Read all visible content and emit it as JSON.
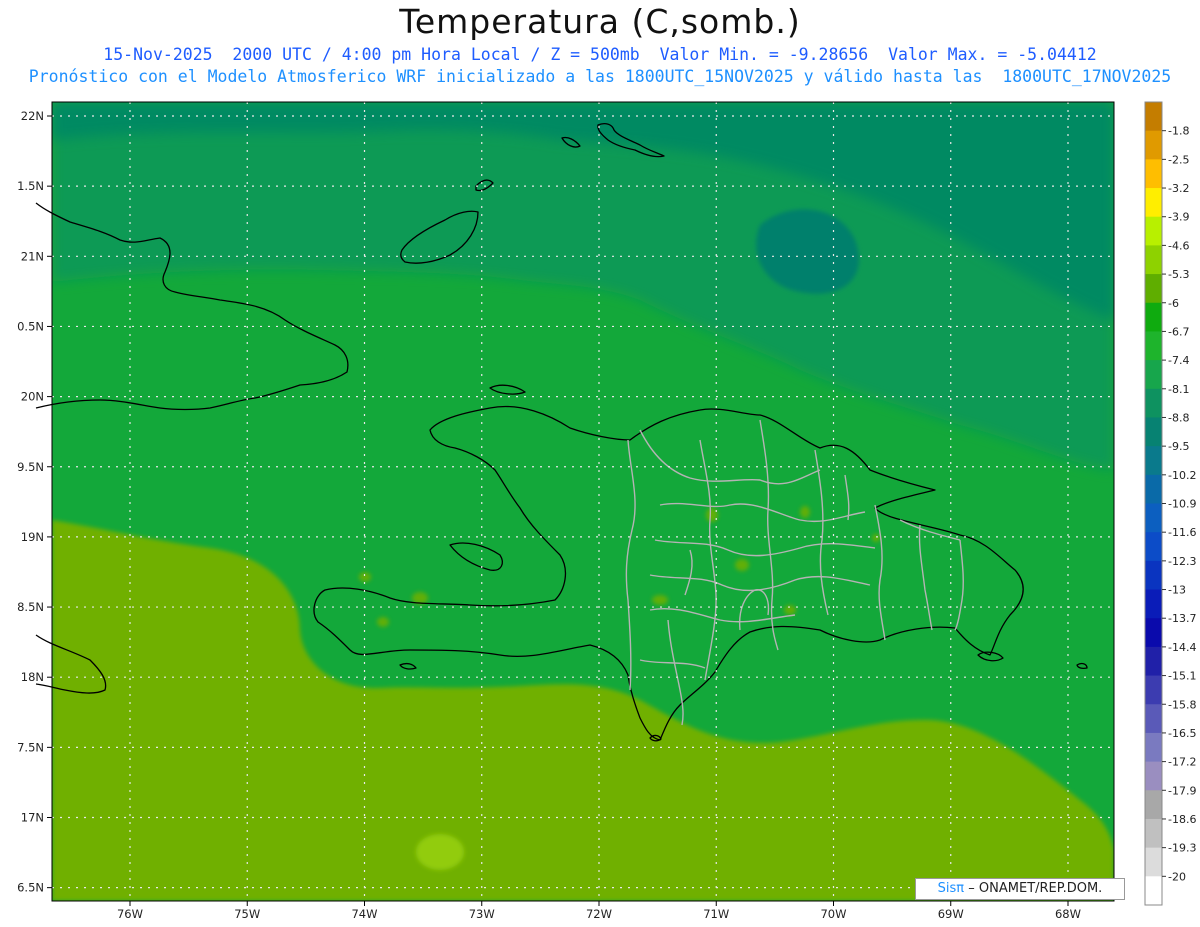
{
  "header": {
    "title": "Temperatura (C,somb.)",
    "subtitle_line1": "15-Nov-2025  2000 UTC / 4:00 pm Hora Local / Z = 500mb  Valor Min. = -9.28656  Valor Max. = -5.04412",
    "subtitle_line2": "Pronóstico con el Modelo Atmosferico WRF inicializado a las 1800UTC_15NOV2025 y válido hasta las  1800UTC_17NOV2025"
  },
  "map": {
    "lat_labels": [
      "22N",
      "1.5N",
      "21N",
      "0.5N",
      "20N",
      "9.5N",
      "19N",
      "8.5N",
      "18N",
      "7.5N",
      "17N",
      "6.5N"
    ],
    "lon_labels": [
      "76W",
      "75W",
      "74W",
      "73W",
      "72W",
      "71W",
      "70W",
      "69W",
      "68W"
    ],
    "lat_values": [
      22,
      21.5,
      21,
      20.5,
      20,
      19.5,
      19,
      18.5,
      18,
      17.5,
      17,
      16.5
    ],
    "lon_values": [
      -76,
      -75,
      -74,
      -73,
      -72,
      -71,
      -70,
      -69,
      -68
    ],
    "grid": "dotted",
    "colors": {
      "darker_teal": "#068a62",
      "teal_green": "#0c9a54",
      "green": "#13a83a",
      "yellow_green": "#6fb000",
      "light_green": "#92cc0e",
      "coastline": "#000000",
      "borders": "#b4b4b4"
    }
  },
  "legend": {
    "labels": [
      "-1.8",
      "-2.5",
      "-3.2",
      "-3.9",
      "-4.6",
      "-5.3",
      "-6",
      "-6.7",
      "-7.4",
      "-8.1",
      "-8.8",
      "-9.5",
      "-10.2",
      "-10.9",
      "-11.6",
      "-12.3",
      "-13",
      "-13.7",
      "-14.4",
      "-15.1",
      "-15.8",
      "-16.5",
      "-17.2",
      "-17.9",
      "-18.6",
      "-19.3",
      "-20"
    ],
    "colors": [
      "#c47d00",
      "#e09a00",
      "#ffbe00",
      "#ffee00",
      "#b8f000",
      "#8ed200",
      "#5fae00",
      "#0fab0f",
      "#1eb42c",
      "#17a64c",
      "#0e9260",
      "#078272",
      "#0a7a8c",
      "#0a6aa8",
      "#0c5fc0",
      "#0c4cc8",
      "#0a34c0",
      "#0a1cb8",
      "#0a0aac",
      "#2020a8",
      "#3c3cb0",
      "#5a5ab8",
      "#7a7ac0",
      "#9a8ec0",
      "#a8a8a8",
      "#c0c0c0",
      "#dcdcdc",
      "#ffffff"
    ]
  },
  "credit": {
    "brand": "Sisπ",
    "text": "– ONAMET/REP.DOM."
  }
}
